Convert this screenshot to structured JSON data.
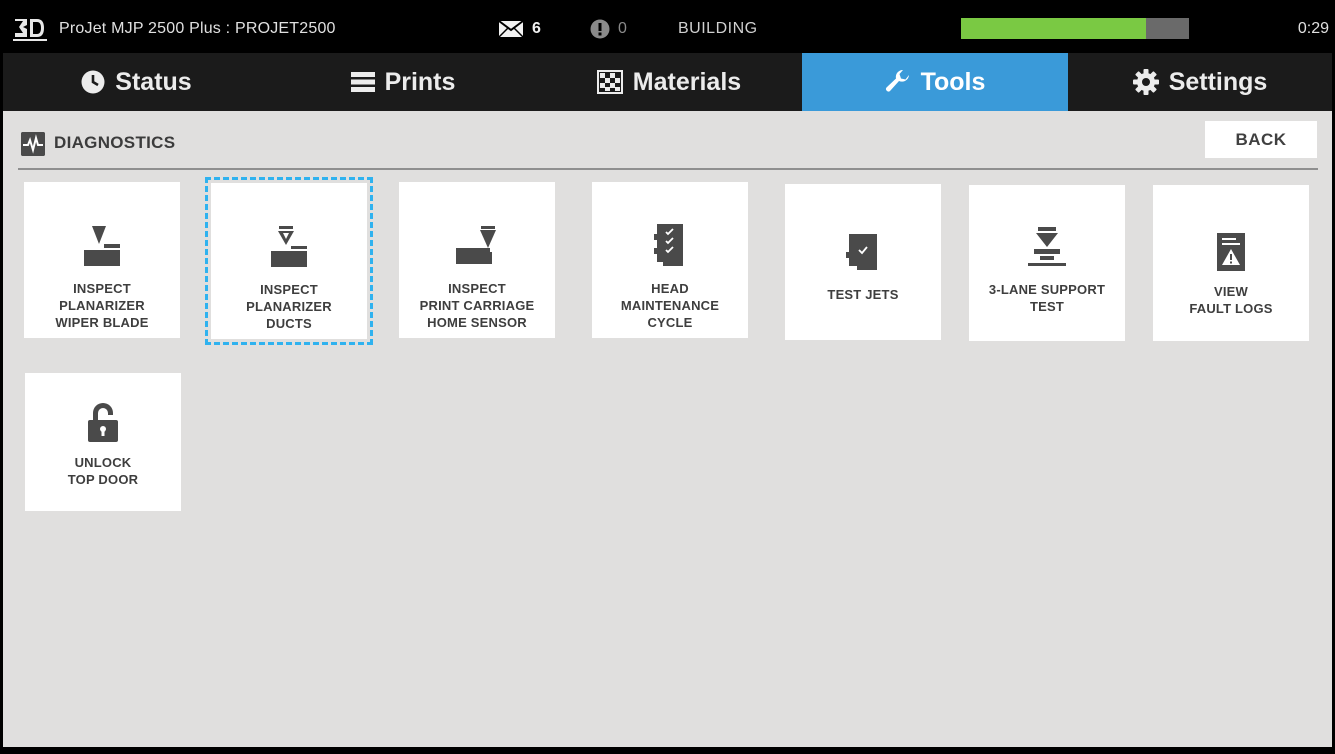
{
  "header": {
    "title": "ProJet MJP 2500 Plus : PROJET2500",
    "messages_count": "6",
    "alerts_count": "0",
    "state": "BUILDING",
    "progress_fraction": 0.81,
    "time": "0:29",
    "progress_color": "#7ac943"
  },
  "tabs": [
    {
      "label": "Status",
      "icon": "clock-icon"
    },
    {
      "label": "Prints",
      "icon": "list-icon"
    },
    {
      "label": "Materials",
      "icon": "checkerboard-icon"
    },
    {
      "label": "Tools",
      "icon": "wrench-icon",
      "active": true
    },
    {
      "label": "Settings",
      "icon": "gear-icon"
    }
  ],
  "accent_color": "#3a9ad9",
  "section": {
    "title": "DIAGNOSTICS",
    "icon": "pulse-icon",
    "back_label": "BACK"
  },
  "tiles": [
    {
      "label": "INSPECT\nPLANARIZER\nWIPER BLADE",
      "icon": "planarizer-wiper-icon"
    },
    {
      "label": "INSPECT\nPLANARIZER\nDUCTS",
      "icon": "planarizer-ducts-icon",
      "selected": true
    },
    {
      "label": "INSPECT\nPRINT CARRIAGE\nHOME SENSOR",
      "icon": "carriage-sensor-icon"
    },
    {
      "label": "HEAD\nMAINTENANCE\nCYCLE",
      "icon": "head-checklist-icon"
    },
    {
      "label": "TEST JETS",
      "icon": "test-jets-icon"
    },
    {
      "label": "3-LANE SUPPORT\nTEST",
      "icon": "support-test-icon"
    },
    {
      "label": "VIEW\nFAULT LOGS",
      "icon": "fault-log-icon"
    },
    {
      "label": "UNLOCK\nTOP DOOR",
      "icon": "unlock-icon"
    }
  ]
}
